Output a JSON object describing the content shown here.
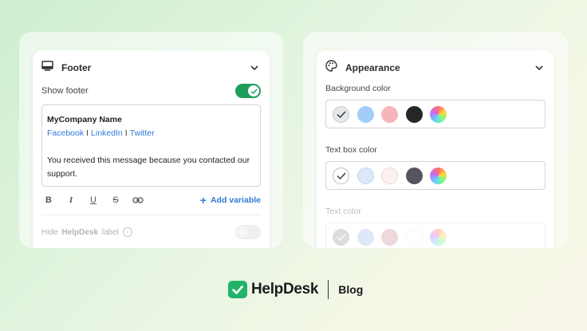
{
  "footer_panel": {
    "title": "Footer",
    "show_footer_label": "Show footer",
    "show_footer_on": true,
    "editor": {
      "company_name": "MyCompany Name",
      "links": [
        "Facebook",
        "LinkedIn",
        "Twitter"
      ],
      "link_separator": "I",
      "message": "You received this message because you contacted our support."
    },
    "toolbar": {
      "bold": "B",
      "italic": "I",
      "underline": "U",
      "strike": "S",
      "add_variable": "Add variable"
    },
    "hide_label": {
      "prefix": "Hide",
      "brand": "HelpDesk",
      "suffix": "label",
      "on": false
    }
  },
  "appearance_panel": {
    "title": "Appearance",
    "background_color": {
      "label": "Background color",
      "swatches": [
        "#e4e8ec",
        "#a3cdf7",
        "#f6b5ba",
        "#262626",
        "gradient"
      ],
      "selected_index": 0
    },
    "text_box_color": {
      "label": "Text box color",
      "swatches": [
        "#ffffff",
        "#dbe9f8",
        "#fcf0f1",
        "#555560",
        "gradient"
      ],
      "selected_index": 0
    },
    "text_color": {
      "label": "Text color",
      "swatches": [
        "#9a9a9a",
        "#a3bde8",
        "#cf8f98",
        "#ffffff",
        "gradient"
      ],
      "selected_index": 0
    }
  },
  "brand": {
    "name": "HelpDesk",
    "section": "Blog",
    "color": "#22b36b"
  },
  "colors": {
    "accent_green": "#1f9d5a",
    "link_blue": "#2f7bd6"
  }
}
